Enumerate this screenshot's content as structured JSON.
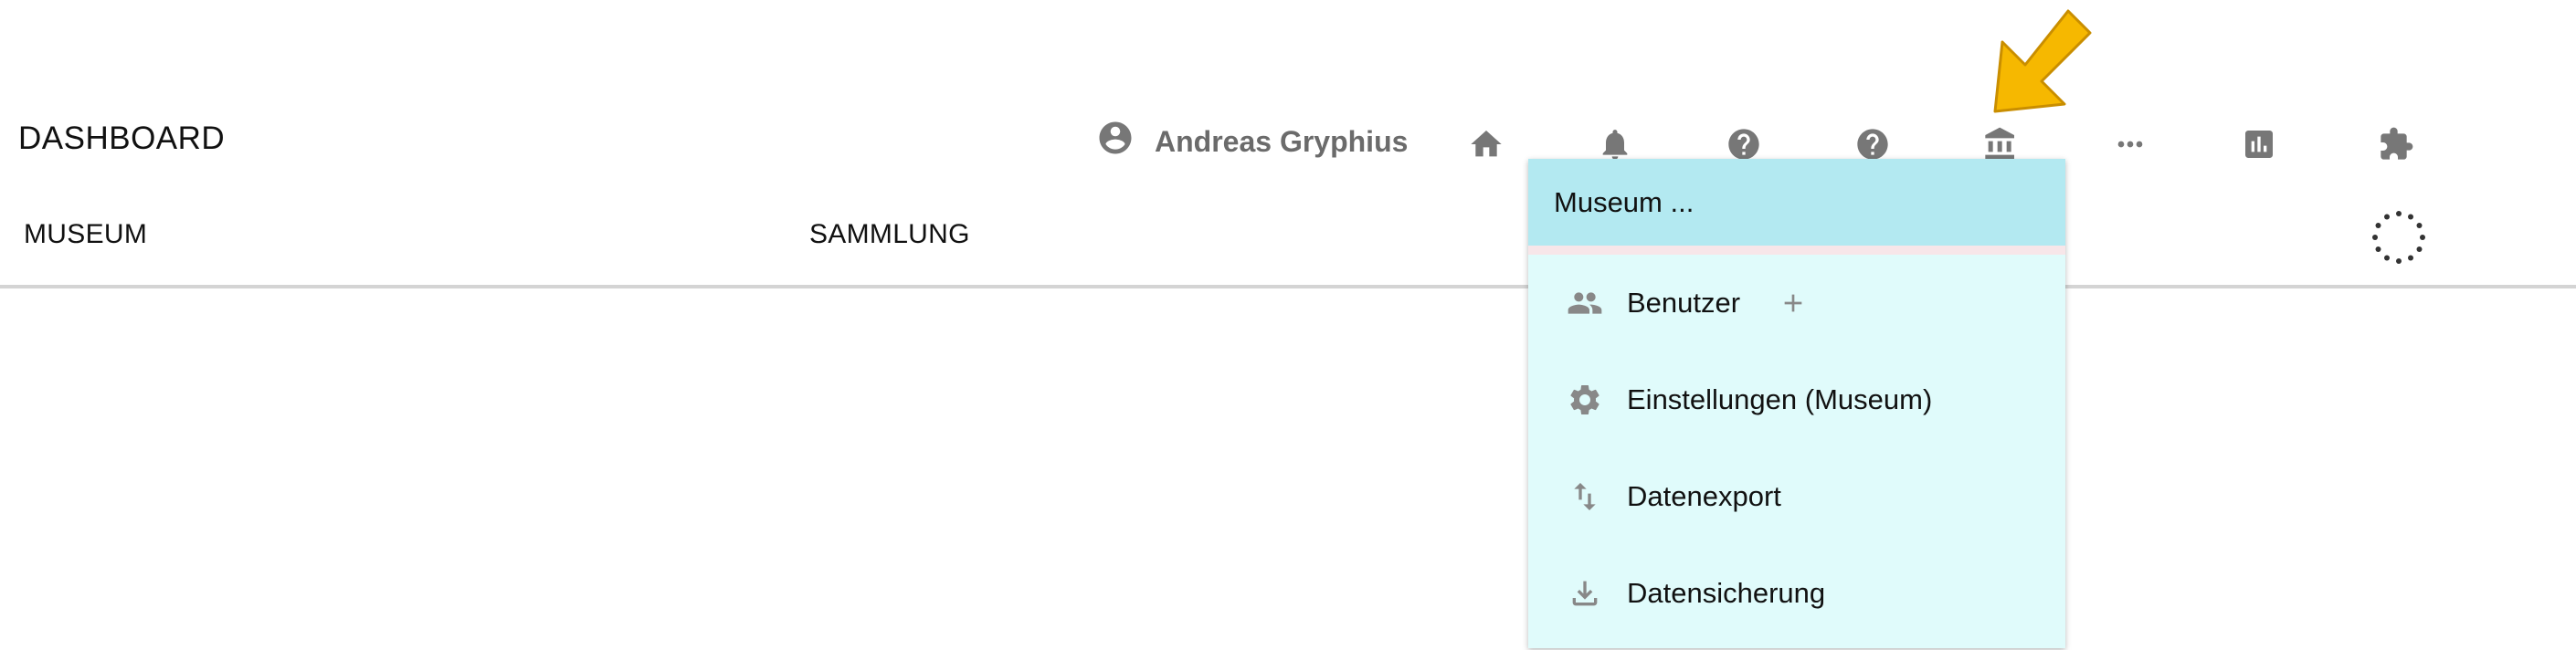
{
  "header": {
    "title": "DASHBOARD",
    "user_name": "Andreas Gryphius",
    "icons": [
      "home-icon",
      "bell-icon",
      "help-icon",
      "help-icon",
      "museum-icon",
      "more-horiz-icon",
      "bar-chart-icon",
      "puzzle-icon"
    ]
  },
  "tabs": [
    {
      "label": "MUSEUM"
    },
    {
      "label": "SAMMLUNG"
    }
  ],
  "menu": {
    "header": "Museum ...",
    "items": [
      {
        "label": "Benutzer",
        "icon": "people-icon"
      },
      {
        "label": "Einstellungen (Museum)",
        "icon": "gear-icon"
      },
      {
        "label": "Datenexport",
        "icon": "swap-vert-icon"
      },
      {
        "label": "Datensicherung",
        "icon": "download-icon"
      }
    ]
  },
  "colors": {
    "menu_background": "#e0fbfb",
    "menu_header": "#b3e9f1",
    "arrow": "#f6b800",
    "icon_gray": "#777777"
  }
}
